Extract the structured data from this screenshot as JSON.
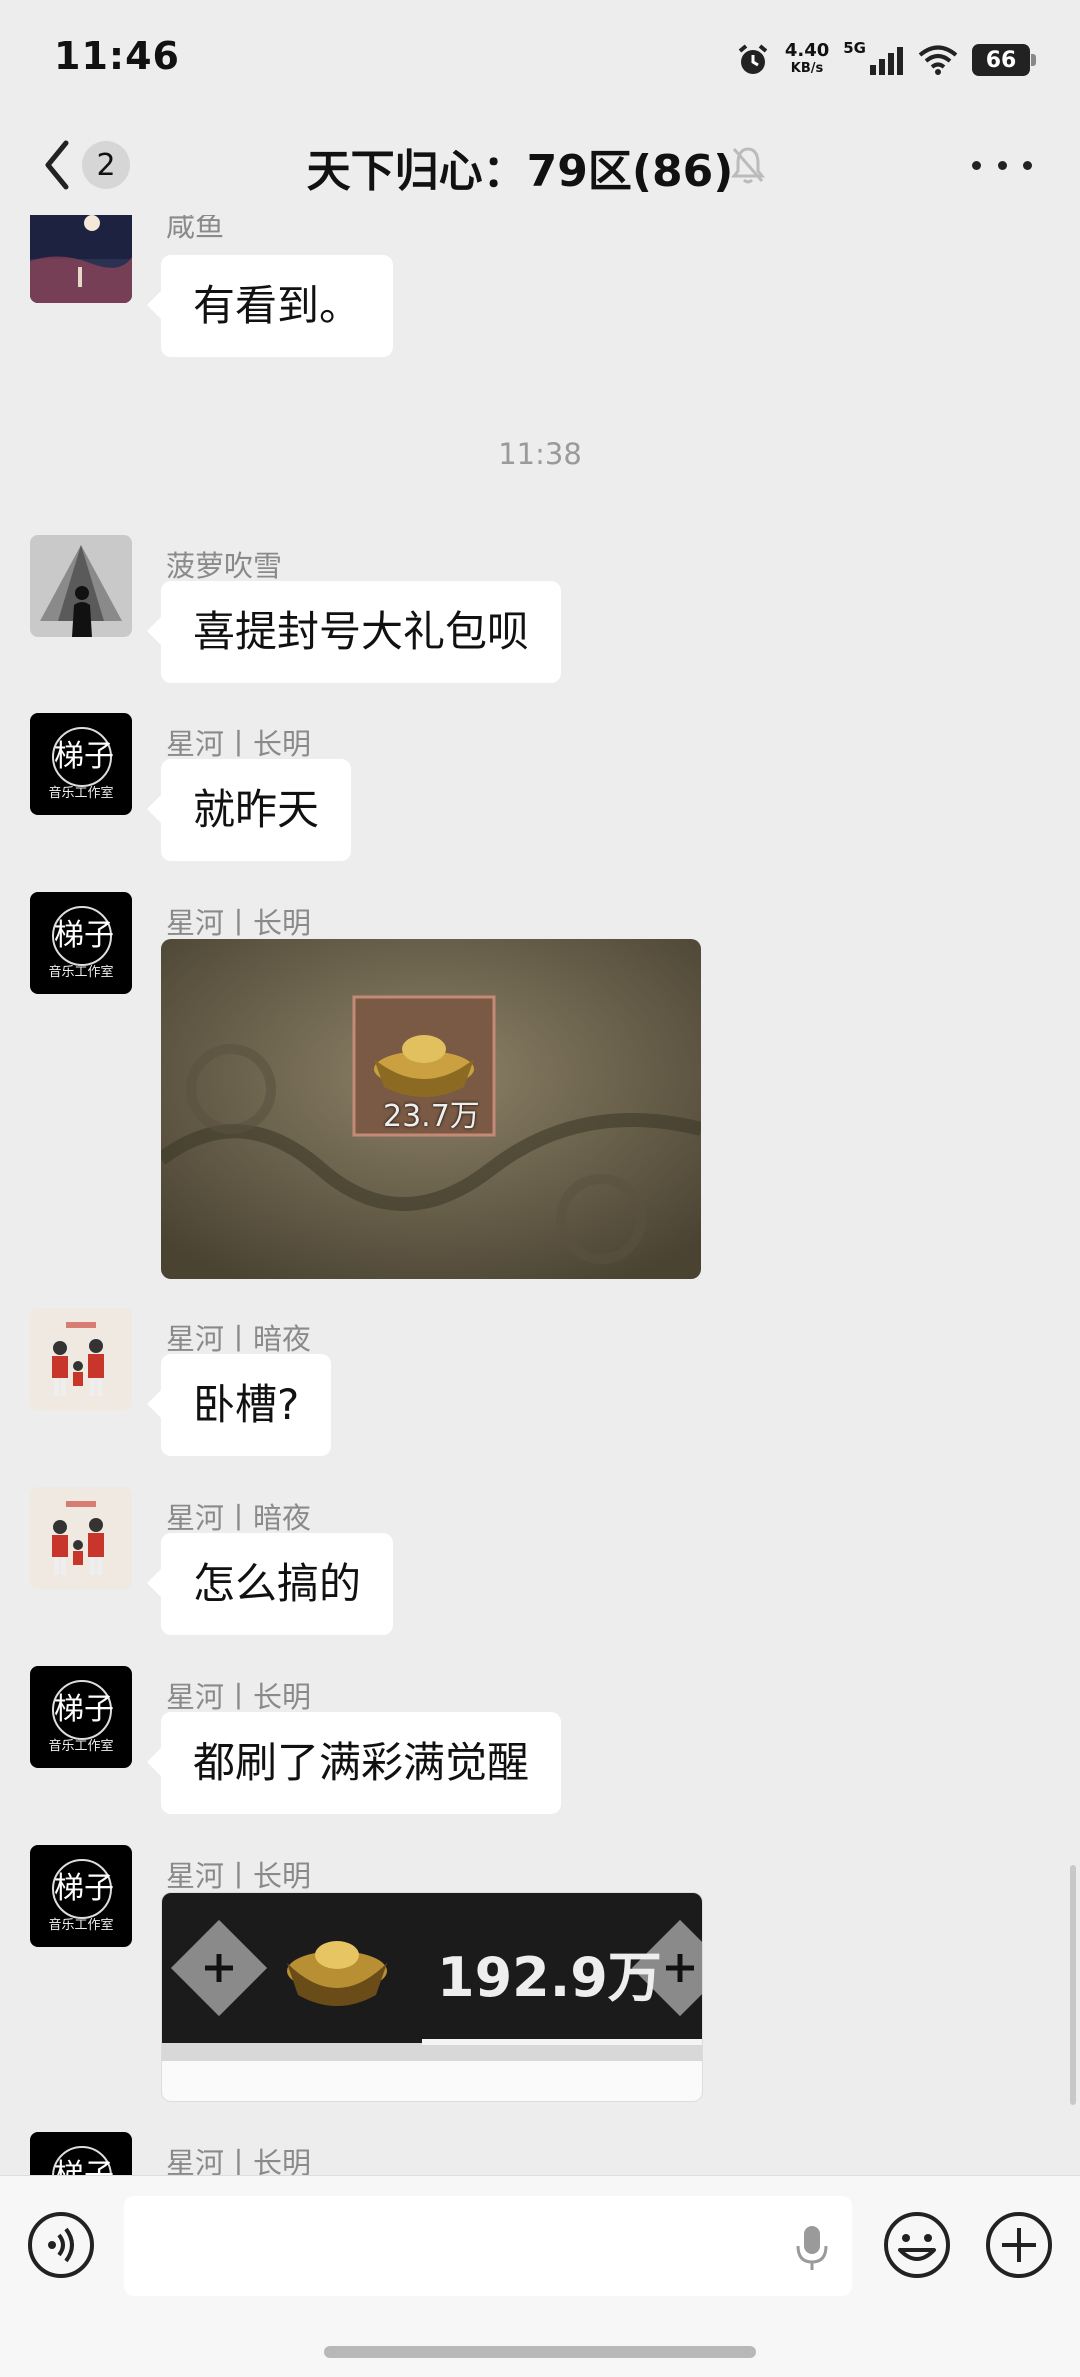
{
  "status_bar": {
    "time": "11:46",
    "net_speed": "4.40",
    "net_unit": "KB/s",
    "network": "5G",
    "battery": "66"
  },
  "header": {
    "unread_count": "2",
    "title": "天下归心：79区(86)"
  },
  "messages": [
    {
      "sender": "咸鱼",
      "text": "有看到。"
    },
    {
      "sender": "菠萝吹雪",
      "text": "喜提封号大礼包呗"
    },
    {
      "sender": "星河丨长明",
      "text": "就昨天"
    },
    {
      "sender": "星河丨长明",
      "image_caption": "23.7万"
    },
    {
      "sender": "星河丨暗夜",
      "text": "卧槽?"
    },
    {
      "sender": "星河丨暗夜",
      "text": "怎么搞的"
    },
    {
      "sender": "星河丨长明",
      "text": "都刷了满彩满觉醒"
    },
    {
      "sender": "星河丨长明",
      "image_caption": "192.9万"
    },
    {
      "sender": "星河丨长明"
    }
  ],
  "timestamp": "11:38",
  "avatar_glyph": "梯子",
  "avatar_caption": "音乐工作室",
  "input": {
    "placeholder": ""
  },
  "colors": {
    "background": "#ededed",
    "bubble": "#ffffff",
    "sender_text": "#8a8a8a"
  }
}
